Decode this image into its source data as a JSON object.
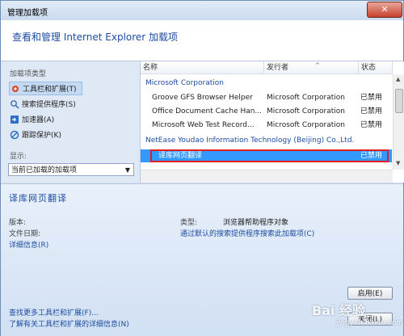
{
  "window": {
    "title": "管理加载项",
    "close_glyph": "✕"
  },
  "header": {
    "title": "查看和管理 Internet Explorer 加载项"
  },
  "left": {
    "types_label": "加载项类型",
    "items": [
      {
        "label": "工具栏和扩展(T)",
        "icon": "gear-icon"
      },
      {
        "label": "搜索提供程序(S)",
        "icon": "search-icon"
      },
      {
        "label": "加速器(A)",
        "icon": "accelerator-icon"
      },
      {
        "label": "跟踪保护(K)",
        "icon": "block-icon"
      }
    ],
    "show_label": "显示:",
    "show_value": "当前已加载的加载项"
  },
  "list": {
    "columns": [
      "名称",
      "发行者",
      "状态"
    ],
    "groups": [
      {
        "name": "Microsoft Corporation",
        "rows": [
          {
            "name": "Groove GFS Browser Helper",
            "publisher": "Microsoft Corporation",
            "status": "已禁用"
          },
          {
            "name": "Office Document Cache Han...",
            "publisher": "Microsoft Corporation",
            "status": "已禁用"
          },
          {
            "name": "Microsoft Web Test Record...",
            "publisher": "Microsoft Corporation",
            "status": "已禁用"
          }
        ]
      },
      {
        "name": "NetEase Youdao Information Technology (Beijing) Co.,Ltd.",
        "rows": [
          {
            "name": "译库网页翻译",
            "publisher": "",
            "status": "已禁用"
          }
        ]
      }
    ]
  },
  "detail": {
    "name": "译库网页翻译",
    "version_label": "版本:",
    "date_label": "文件日期:",
    "more_info": "详细信息(R)",
    "type_label": "类型:",
    "type_value": "浏览器帮助程序对象",
    "search_link": "通过默认的搜索提供程序搜索此加载项(C)",
    "enable_button": "启用(E)",
    "close_button": "关闭(L)",
    "find_more_link": "查找更多工具栏和扩展(F)...",
    "learn_more_link": "了解有关工具栏和扩展的详细信息(N)"
  },
  "watermark": {
    "brand": "Bai 经验",
    "sub": "jingyan.baidu.com"
  },
  "colors": {
    "accent": "#1d4da0",
    "selection": "#3399ff",
    "highlight_box": "#e41d1d"
  }
}
